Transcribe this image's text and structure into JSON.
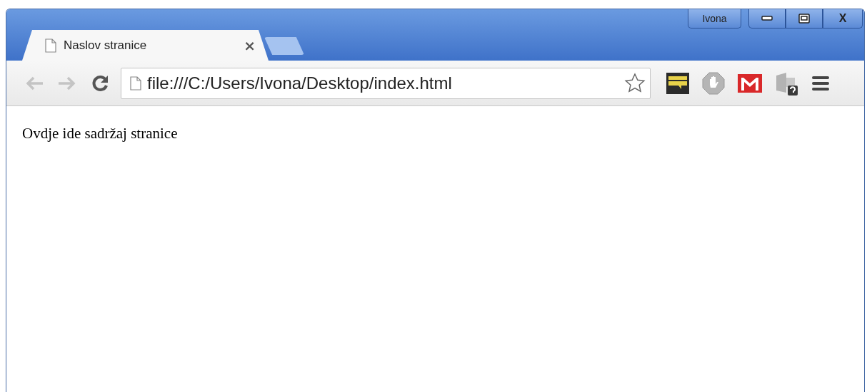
{
  "window": {
    "profile": "Ivona",
    "close": "X"
  },
  "tabs": [
    {
      "label": "Naslov stranice",
      "close": "×",
      "selected": true
    }
  ],
  "toolbar": {
    "back_disabled": true,
    "forward_disabled": true,
    "address": "file:///C:/Users/Ivona/Desktop/index.html"
  },
  "page": {
    "text": "Ovdje ide sadržaj stranice"
  }
}
